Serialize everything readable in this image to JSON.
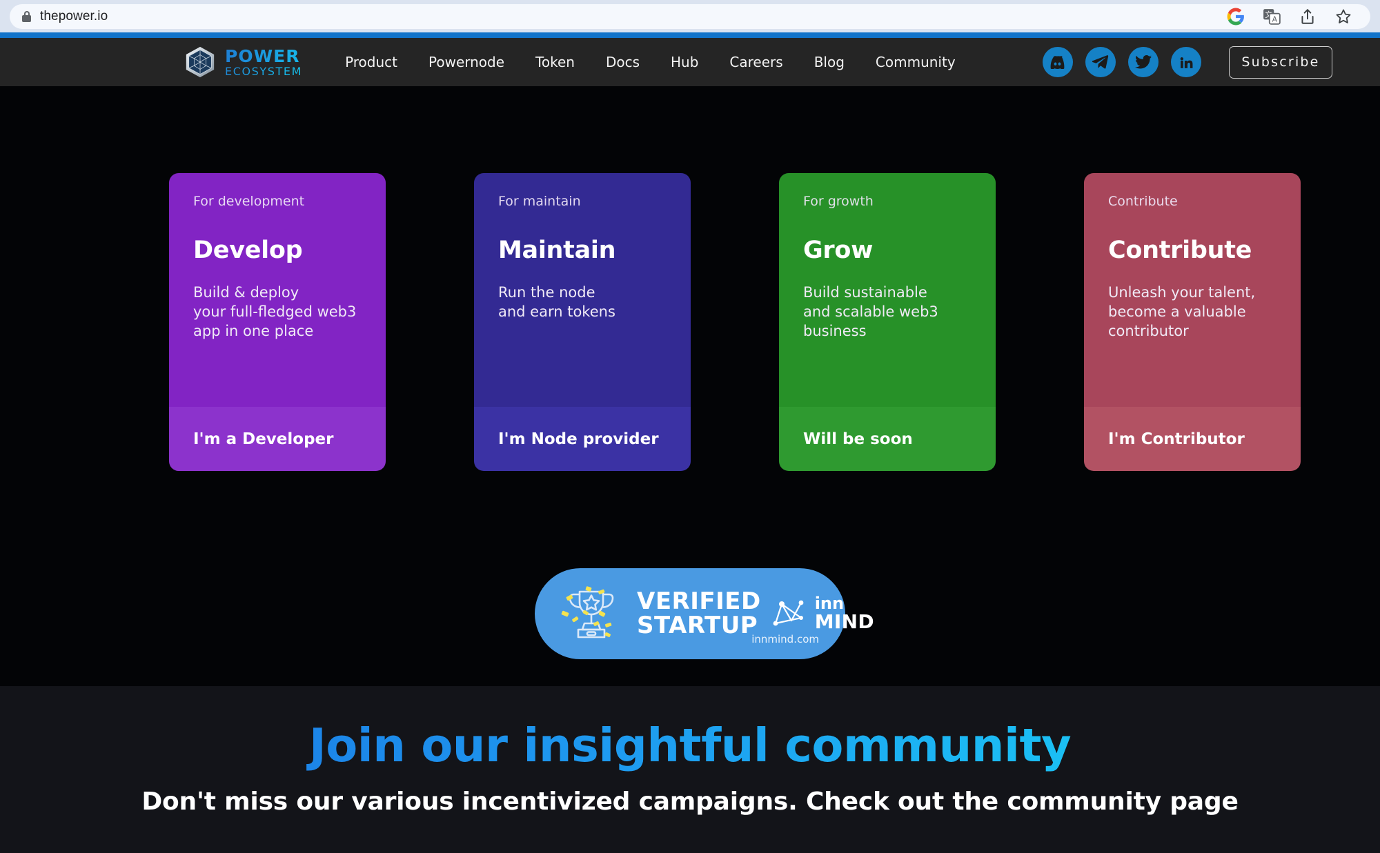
{
  "browser": {
    "url": "thepower.io",
    "lock_icon": "lock-icon",
    "actions": [
      {
        "name": "google-icon",
        "label": "Google"
      },
      {
        "name": "translate-icon",
        "label": "Translate"
      },
      {
        "name": "share-icon",
        "label": "Share"
      },
      {
        "name": "bookmark-star-icon",
        "label": "Bookmark"
      }
    ]
  },
  "header": {
    "logo": {
      "icon": "icosahedron-logo-icon",
      "power": "POWER",
      "ecosystem": "ECOSYSTEM"
    },
    "nav": [
      {
        "label": "Product"
      },
      {
        "label": "Powernode"
      },
      {
        "label": "Token"
      },
      {
        "label": "Docs"
      },
      {
        "label": "Hub"
      },
      {
        "label": "Careers"
      },
      {
        "label": "Blog"
      },
      {
        "label": "Community"
      }
    ],
    "socials": [
      {
        "name": "discord-icon",
        "label": "Discord"
      },
      {
        "name": "telegram-icon",
        "label": "Telegram"
      },
      {
        "name": "twitter-icon",
        "label": "Twitter"
      },
      {
        "name": "linkedin-icon",
        "label": "LinkedIn"
      }
    ],
    "subscribe_label": "Subscribe",
    "accent_color": "#1581c6",
    "bar_color": "#1273c9",
    "background": "#252525"
  },
  "hero": {
    "background": "#030406",
    "cards": [
      {
        "eyebrow": "For development",
        "title": "Develop",
        "description": "Build & deploy\nyour full-fledged web3\napp in one place",
        "cta": "I'm a Developer",
        "color": "#8224c4",
        "footer_color": "#8c33cc"
      },
      {
        "eyebrow": "For maintain",
        "title": "Maintain",
        "description": "Run the node\nand earn tokens",
        "cta": "I'm Node provider",
        "color": "#332a93",
        "footer_color": "#3b32a4"
      },
      {
        "eyebrow": "For growth",
        "title": "Grow",
        "description": "Build sustainable\nand scalable web3\nbusiness",
        "cta": "Will be soon",
        "color": "#279128",
        "footer_color": "#2f9a30"
      },
      {
        "eyebrow": "Contribute",
        "title": "Contribute",
        "description": "Unleash your talent,\nbecome a valuable\ncontributor",
        "cta": "I'm Contributor",
        "color": "#a8465b",
        "footer_color": "#b25263"
      }
    ],
    "badge": {
      "icon": "trophy-icon",
      "line1": "VERIFIED",
      "line2": "STARTUP",
      "partner_icon": "innmind-logo-icon",
      "partner_inn": "inn",
      "partner_mind": "MIND",
      "partner_url": "innmind.com",
      "color": "#4a9ae2"
    }
  },
  "community": {
    "title": "Join our insightful community",
    "subtitle": "Don't miss our various incentivized campaigns. Check out the community page",
    "background": "#131419",
    "gradient_from": "#1a6fe0",
    "gradient_to": "#19d9f7"
  }
}
